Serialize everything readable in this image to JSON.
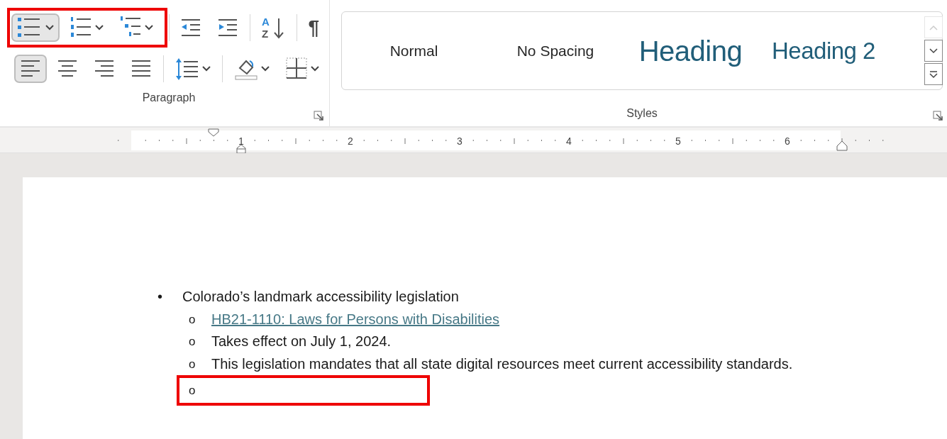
{
  "ribbon": {
    "paragraph": {
      "label": "Paragraph",
      "highlight_first_three": true,
      "rows": [
        [
          {
            "kind": "bullets",
            "selected": true,
            "dropdown": true
          },
          {
            "kind": "numbering",
            "selected": false,
            "dropdown": true
          },
          {
            "kind": "multilevel",
            "selected": false,
            "dropdown": true
          },
          {
            "kind": "separator"
          },
          {
            "kind": "outdent",
            "selected": false
          },
          {
            "kind": "indent",
            "selected": false
          },
          {
            "kind": "separator"
          },
          {
            "kind": "sort",
            "selected": false,
            "letters": [
              "A",
              "Z"
            ]
          },
          {
            "kind": "separator"
          },
          {
            "kind": "pilcrow",
            "selected": false,
            "label": "¶"
          }
        ],
        [
          {
            "kind": "align-left",
            "selected": true
          },
          {
            "kind": "align-center",
            "selected": false
          },
          {
            "kind": "align-right",
            "selected": false
          },
          {
            "kind": "justify",
            "selected": false
          },
          {
            "kind": "separator"
          },
          {
            "kind": "line-spacing",
            "selected": false,
            "dropdown": true
          },
          {
            "kind": "separator"
          },
          {
            "kind": "shading",
            "selected": false,
            "dropdown": true
          },
          {
            "kind": "borders",
            "selected": false,
            "dropdown": true
          }
        ]
      ]
    },
    "styles": {
      "label": "Styles",
      "items": [
        {
          "name": "Normal",
          "kind": "normal"
        },
        {
          "name": "No Spacing",
          "kind": "normal"
        },
        {
          "name": "Heading",
          "kind": "heading1"
        },
        {
          "name": "Heading 2",
          "kind": "heading2"
        }
      ]
    }
  },
  "ruler": {
    "numbers": [
      "1",
      "2",
      "3",
      "4",
      "5",
      "6"
    ]
  },
  "document": {
    "items": [
      {
        "marker": "•",
        "text": "Colorado’s landmark accessibility legislation",
        "highlighted": false,
        "children": [
          {
            "marker": "o",
            "text": "HB21-1110: Laws for Persons with Disabilities",
            "link": true,
            "highlighted": false
          },
          {
            "marker": "o",
            "text": "Takes effect on July 1, 2024.",
            "link": false,
            "highlighted": false
          },
          {
            "marker": "o",
            "text": "This legislation mandates that all state digital resources meet current accessibility standards.",
            "link": false,
            "highlighted": false
          },
          {
            "marker": "o",
            "highlighted": true
          }
        ]
      }
    ]
  }
}
